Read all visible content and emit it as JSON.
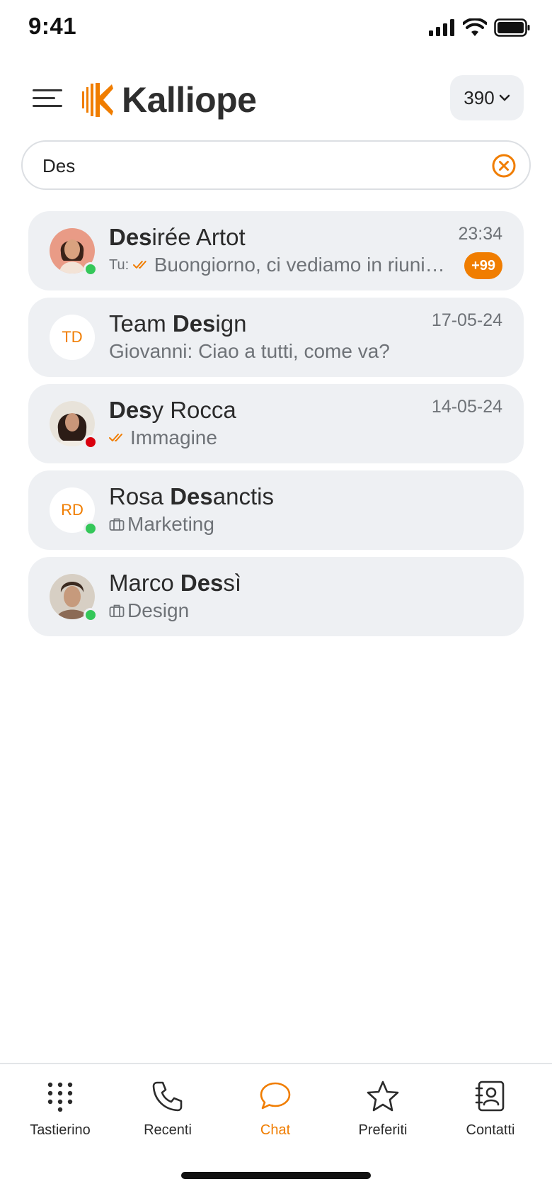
{
  "status_bar": {
    "time": "9:41"
  },
  "header": {
    "logo_text": "Kalliope",
    "extension": "390"
  },
  "search": {
    "value": "Des",
    "placeholder": ""
  },
  "accent_color": "#f07d00",
  "results": [
    {
      "name_bold": "Des",
      "name_rest": "irée Artot",
      "name_prefix": "",
      "avatar_type": "photo",
      "presence": "online",
      "sender": "Tu:",
      "read_icon": "double-check-icon",
      "subtitle": "Buongiorno, ci vediamo in riunione",
      "time": "23:34",
      "badge": "+99"
    },
    {
      "name_prefix": "Team ",
      "name_bold": "Des",
      "name_rest": "ign",
      "avatar_type": "initials",
      "initials": "TD",
      "subtitle": "Giovanni: Ciao a tutti, come va?",
      "time": "17-05-24"
    },
    {
      "name_prefix": "",
      "name_bold": "Des",
      "name_rest": "y Rocca",
      "avatar_type": "photo",
      "presence": "busy",
      "read_icon": "double-check-icon",
      "subtitle": "Immagine",
      "time": "14-05-24"
    },
    {
      "name_prefix": "Rosa ",
      "name_bold": "Des",
      "name_rest": "anctis",
      "avatar_type": "initials",
      "initials": "RD",
      "presence": "online",
      "dept_icon": "briefcase-icon",
      "subtitle": "Marketing"
    },
    {
      "name_prefix": "Marco ",
      "name_bold": "Des",
      "name_rest": "sì",
      "avatar_type": "photo",
      "presence": "online",
      "dept_icon": "briefcase-icon",
      "subtitle": "Design"
    }
  ],
  "tabs": [
    {
      "label": "Tastierino",
      "icon": "keypad-icon"
    },
    {
      "label": "Recenti",
      "icon": "phone-icon"
    },
    {
      "label": "Chat",
      "icon": "chat-bubble-icon",
      "active": true
    },
    {
      "label": "Preferiti",
      "icon": "star-icon"
    },
    {
      "label": "Contatti",
      "icon": "contacts-icon"
    }
  ]
}
